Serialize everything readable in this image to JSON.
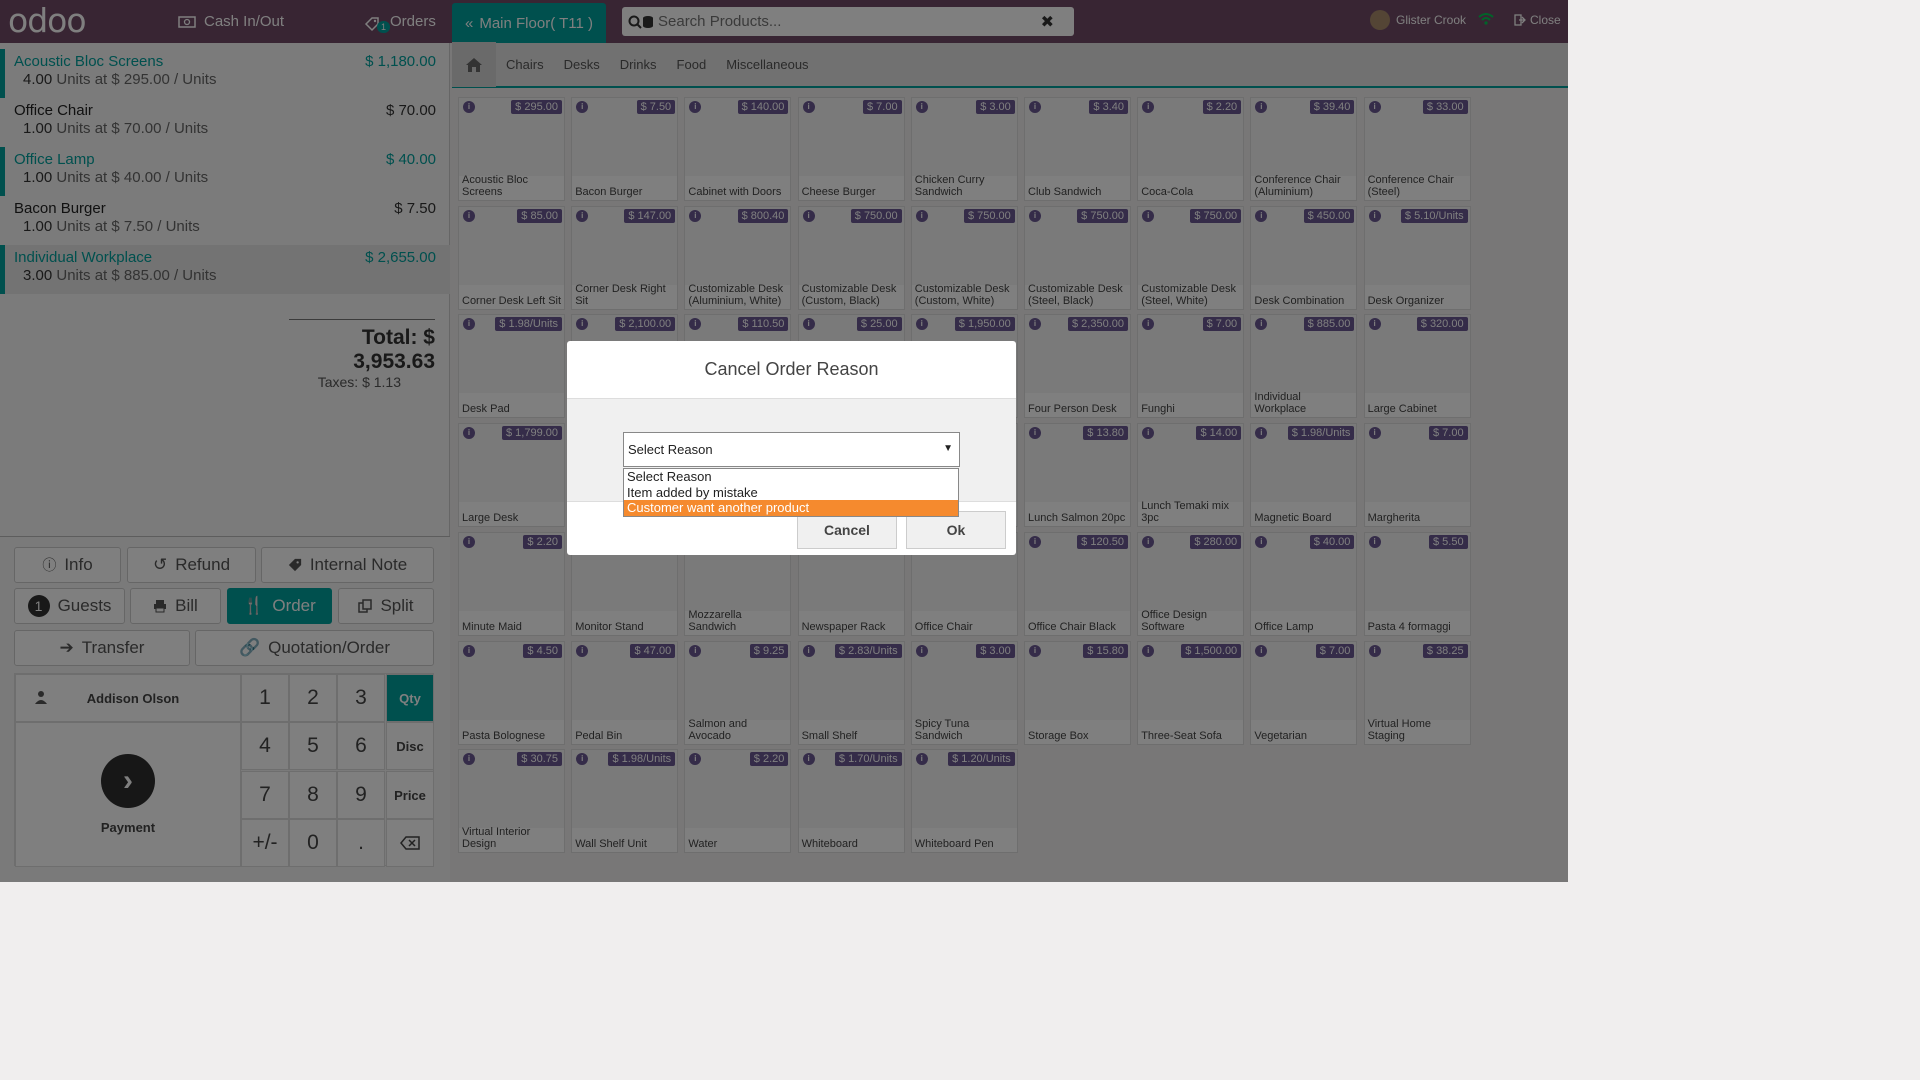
{
  "header": {
    "logo": "odoo",
    "cash_label": "Cash In/Out",
    "orders_label": "Orders",
    "orders_badge": "1",
    "floor_label": "Main Floor( T11 )",
    "search_placeholder": "Search Products...",
    "user_name": "Glister Crook",
    "close_label": "Close"
  },
  "order": {
    "lines": [
      {
        "name": "Acoustic Bloc Screens",
        "price": "$ 1,180.00",
        "qty": "4.00",
        "detail": "Units at $ 295.00 / Units"
      },
      {
        "name": "Office Chair",
        "price": "$ 70.00",
        "qty": "1.00",
        "detail": "Units at $ 70.00 / Units"
      },
      {
        "name": "Office Lamp",
        "price": "$ 40.00",
        "qty": "1.00",
        "detail": "Units at $ 40.00 / Units"
      },
      {
        "name": "Bacon Burger",
        "price": "$ 7.50",
        "qty": "1.00",
        "detail": "Units at $ 7.50 / Units"
      },
      {
        "name": "Individual Workplace",
        "price": "$ 2,655.00",
        "qty": "3.00",
        "detail": "Units at $ 885.00 / Units"
      }
    ],
    "total": "Total: $ 3,953.63",
    "taxes": "Taxes: $ 1.13"
  },
  "actions": {
    "info": "Info",
    "refund": "Refund",
    "internal_note": "Internal Note",
    "guests_count": "1",
    "guests": "Guests",
    "bill": "Bill",
    "order": "Order",
    "split": "Split",
    "transfer": "Transfer",
    "quotation": "Quotation/Order"
  },
  "numpad": {
    "customer": "Addison Olson",
    "payment": "Payment",
    "keys": [
      "1",
      "2",
      "3",
      "4",
      "5",
      "6",
      "7",
      "8",
      "9",
      "+/-",
      "0",
      "."
    ],
    "qty": "Qty",
    "disc": "Disc",
    "price": "Price"
  },
  "categories": [
    "Chairs",
    "Desks",
    "Drinks",
    "Food",
    "Miscellaneous"
  ],
  "products": [
    {
      "name": "Acoustic Bloc Screens",
      "price": "$ 295.00"
    },
    {
      "name": "Bacon Burger",
      "price": "$ 7.50"
    },
    {
      "name": "Cabinet with Doors",
      "price": "$ 140.00"
    },
    {
      "name": "Cheese Burger",
      "price": "$ 7.00"
    },
    {
      "name": "Chicken Curry Sandwich",
      "price": "$ 3.00"
    },
    {
      "name": "Club Sandwich",
      "price": "$ 3.40"
    },
    {
      "name": "Coca-Cola",
      "price": "$ 2.20"
    },
    {
      "name": "Conference Chair (Aluminium)",
      "price": "$ 39.40"
    },
    {
      "name": "Conference Chair (Steel)",
      "price": "$ 33.00"
    },
    {
      "name": "Corner Desk Left Sit",
      "price": "$ 85.00"
    },
    {
      "name": "Corner Desk Right Sit",
      "price": "$ 147.00"
    },
    {
      "name": "Customizable Desk (Aluminium, White)",
      "price": "$ 800.40"
    },
    {
      "name": "Customizable Desk (Custom, Black)",
      "price": "$ 750.00"
    },
    {
      "name": "Customizable Desk (Custom, White)",
      "price": "$ 750.00"
    },
    {
      "name": "Customizable Desk (Steel, Black)",
      "price": "$ 750.00"
    },
    {
      "name": "Customizable Desk (Steel, White)",
      "price": "$ 750.00"
    },
    {
      "name": "Desk Combination",
      "price": "$ 450.00"
    },
    {
      "name": "Desk Organizer",
      "price": "$ 5.10/Units"
    },
    {
      "name": "Desk Pad",
      "price": "$ 1.98/Units"
    },
    {
      "name": "",
      "price": "$ 2,100.00"
    },
    {
      "name": "",
      "price": "$ 110.50"
    },
    {
      "name": "",
      "price": "$ 25.00"
    },
    {
      "name": "",
      "price": "$ 1,950.00"
    },
    {
      "name": "Four Person Desk",
      "price": "$ 2,350.00"
    },
    {
      "name": "Funghi",
      "price": "$ 7.00"
    },
    {
      "name": "Individual Workplace",
      "price": "$ 885.00"
    },
    {
      "name": "Large Cabinet",
      "price": "$ 320.00"
    },
    {
      "name": "Large Desk",
      "price": "$ 1,799.00"
    },
    {
      "name": "",
      "price": ""
    },
    {
      "name": "",
      "price": ""
    },
    {
      "name": "",
      "price": ""
    },
    {
      "name": "",
      "price": ""
    },
    {
      "name": "Lunch Salmon 20pc",
      "price": "$ 13.80"
    },
    {
      "name": "Lunch Temaki mix 3pc",
      "price": "$ 14.00"
    },
    {
      "name": "Magnetic Board",
      "price": "$ 1.98/Units"
    },
    {
      "name": "Margherita",
      "price": "$ 7.00"
    },
    {
      "name": "Minute Maid",
      "price": "$ 2.20"
    },
    {
      "name": "Monitor Stand",
      "price": ""
    },
    {
      "name": "Mozzarella Sandwich",
      "price": ""
    },
    {
      "name": "Newspaper Rack",
      "price": ""
    },
    {
      "name": "Office Chair",
      "price": ""
    },
    {
      "name": "Office Chair Black",
      "price": "$ 120.50"
    },
    {
      "name": "Office Design Software",
      "price": "$ 280.00"
    },
    {
      "name": "Office Lamp",
      "price": "$ 40.00"
    },
    {
      "name": "Pasta 4 formaggi",
      "price": "$ 5.50"
    },
    {
      "name": "Pasta Bolognese",
      "price": "$ 4.50"
    },
    {
      "name": "Pedal Bin",
      "price": "$ 47.00"
    },
    {
      "name": "Salmon and Avocado",
      "price": "$ 9.25"
    },
    {
      "name": "Small Shelf",
      "price": "$ 2.83/Units"
    },
    {
      "name": "Spicy Tuna Sandwich",
      "price": "$ 3.00"
    },
    {
      "name": "Storage Box",
      "price": "$ 15.80"
    },
    {
      "name": "Three-Seat Sofa",
      "price": "$ 1,500.00"
    },
    {
      "name": "Vegetarian",
      "price": "$ 7.00"
    },
    {
      "name": "Virtual Home Staging",
      "price": "$ 38.25"
    },
    {
      "name": "Virtual Interior Design",
      "price": "$ 30.75"
    },
    {
      "name": "Wall Shelf Unit",
      "price": "$ 1.98/Units"
    },
    {
      "name": "Water",
      "price": "$ 2.20"
    },
    {
      "name": "Whiteboard",
      "price": "$ 1.70/Units"
    },
    {
      "name": "Whiteboard Pen",
      "price": "$ 1.20/Units"
    }
  ],
  "modal": {
    "title": "Cancel Order Reason",
    "select_value": "Select Reason",
    "options": [
      "Select Reason",
      "Item added by mistake",
      "Customer want another product"
    ],
    "cancel": "Cancel",
    "ok": "Ok"
  },
  "colors": {
    "brand": "#714b67",
    "accent": "#00a09d",
    "price_tag": "#6a5892",
    "option_highlight": "#f58a2e"
  }
}
